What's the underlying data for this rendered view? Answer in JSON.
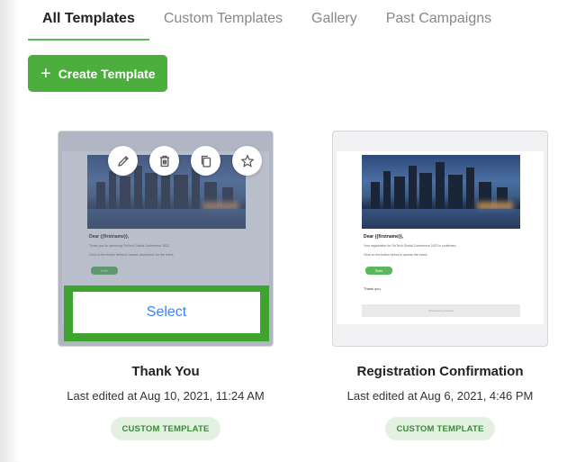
{
  "tabs": [
    {
      "label": "All Templates",
      "active": true
    },
    {
      "label": "Custom Templates",
      "active": false
    },
    {
      "label": "Gallery",
      "active": false
    },
    {
      "label": "Past Campaigns",
      "active": false
    }
  ],
  "create_button": {
    "label": "Create Template",
    "icon": "plus-icon"
  },
  "templates": [
    {
      "name": "Thank You",
      "edited": "Last edited at Aug 10, 2021, 11:24 AM",
      "badge": "CUSTOM TEMPLATE",
      "hovered": true,
      "select_label": "Select",
      "actions": [
        "edit-icon",
        "trash-icon",
        "copy-icon",
        "star-icon"
      ],
      "preview": {
        "greeting": "Dear {{firstname}},",
        "line1": "Thank you for attending FinTech Global Conference 2022.",
        "line2": "Click on the button below to access documents for the event:",
        "button": "Enter"
      }
    },
    {
      "name": "Registration Confirmation",
      "edited": "Last edited at Aug 6, 2021, 4:46 PM",
      "badge": "CUSTOM TEMPLATE",
      "hovered": false,
      "preview": {
        "greeting": "Dear {{firstname}},",
        "line1": "Your registration for FinTech Global Conference 2022 is confirmed.",
        "line2": "Click on the button below to access the event:",
        "button": "Enter",
        "thanks": "Thank you.",
        "footer": "Powered by Airmeet"
      }
    }
  ],
  "colors": {
    "accent_green": "#4cae3c",
    "link_blue": "#3b82f6",
    "badge_bg": "#e3f1e0"
  }
}
